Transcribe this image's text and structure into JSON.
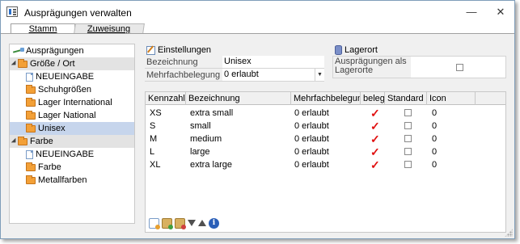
{
  "window": {
    "title": "Ausprägungen verwalten",
    "minimize": "—",
    "close": "✕"
  },
  "tabs": [
    {
      "label": "Stamm",
      "active": true
    },
    {
      "label": "Zuweisung",
      "active": false
    }
  ],
  "tree": {
    "root": "Ausprägungen",
    "items": [
      {
        "label": "Größe / Ort",
        "kind": "group",
        "icon": "folder-icon"
      },
      {
        "label": "NEUEINGABE",
        "kind": "new",
        "icon": "document-icon"
      },
      {
        "label": "Schuhgrößen",
        "kind": "item",
        "icon": "folder-icon"
      },
      {
        "label": "Lager International",
        "kind": "item",
        "icon": "folder-icon"
      },
      {
        "label": "Lager National",
        "kind": "item",
        "icon": "folder-icon"
      },
      {
        "label": "Unisex",
        "kind": "item",
        "icon": "folder-icon",
        "selected": true
      },
      {
        "label": "Farbe",
        "kind": "group",
        "icon": "folder-icon"
      },
      {
        "label": "NEUEINGABE",
        "kind": "new",
        "icon": "document-icon"
      },
      {
        "label": "Farbe",
        "kind": "item",
        "icon": "folder-icon"
      },
      {
        "label": "Metallfarben",
        "kind": "item",
        "icon": "folder-icon"
      }
    ]
  },
  "einstellungen": {
    "title": "Einstellungen",
    "bezeichnung_label": "Bezeichnung",
    "bezeichnung_value": "Unisex",
    "mehrfach_label": "Mehrfachbelegung",
    "mehrfach_value": "0 erlaubt"
  },
  "lagerort": {
    "title": "Lagerort",
    "label": "Ausprägungen als Lagerorte",
    "checked": false
  },
  "grid": {
    "headers": {
      "kennzahl": "Kennzahl",
      "bezeichnung": "Bezeichnung",
      "mehrfach": "Mehrfachbelegung",
      "belegt": "belegt",
      "standard": "Standard",
      "icon": "Icon"
    },
    "rows": [
      {
        "kennzahl": "XS",
        "bezeichnung": "extra small",
        "mehrfach": "0 erlaubt",
        "belegt": "✓",
        "standard": false,
        "icon": "0"
      },
      {
        "kennzahl": "S",
        "bezeichnung": "small",
        "mehrfach": "0 erlaubt",
        "belegt": "✓",
        "standard": false,
        "icon": "0"
      },
      {
        "kennzahl": "M",
        "bezeichnung": "medium",
        "mehrfach": "0 erlaubt",
        "belegt": "✓",
        "standard": false,
        "icon": "0"
      },
      {
        "kennzahl": "L",
        "bezeichnung": "large",
        "mehrfach": "0 erlaubt",
        "belegt": "✓",
        "standard": false,
        "icon": "0"
      },
      {
        "kennzahl": "XL",
        "bezeichnung": "extra large",
        "mehrfach": "0 erlaubt",
        "belegt": "✓",
        "standard": false,
        "icon": "0"
      }
    ]
  },
  "toolbar": [
    "new-record-icon",
    "add-row-icon",
    "delete-row-icon",
    "move-down-icon",
    "move-up-icon",
    "info-icon"
  ],
  "colors": {
    "selected_row": "#c6d5ec",
    "group_row": "#e3e3e3",
    "check": "#e01010",
    "folder": "#f3a037"
  }
}
